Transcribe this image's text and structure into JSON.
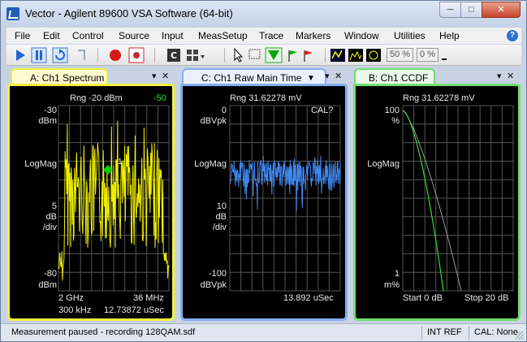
{
  "window": {
    "title": "Vector - Agilent 89600 VSA Software (64-bit)",
    "min_icon": "minimize-icon",
    "max_icon": "maximize-icon",
    "close_icon": "close-icon"
  },
  "menu": [
    "File",
    "Edit",
    "Control",
    "Source",
    "Input",
    "MeasSetup",
    "Trace",
    "Markers",
    "Window",
    "Utilities",
    "Help"
  ],
  "toolbar": {
    "zoom_a": "50 %",
    "zoom_b": "0 %"
  },
  "tabs": [
    {
      "label": "A: Ch1 Spectrum"
    },
    {
      "label": "C: Ch1 Raw Main Time"
    },
    {
      "label": "B: Ch1 CCDF"
    }
  ],
  "pane_a": {
    "range": "Rng -20 dBm",
    "marker_value": "-50",
    "top_val": "-30",
    "top_unit": "dBm",
    "format": "LogMag",
    "div_val": "5",
    "div_unit1": "dB",
    "div_unit2": "/div",
    "bottom_val": "-80",
    "bottom_unit": "dBm",
    "center": "2 GHz",
    "span": "36 MHz",
    "rbw": "300 kHz",
    "time": "12.73872 uSec",
    "marker_label": "1",
    "trace_color": "#f0f000",
    "marker_color": "#00d000"
  },
  "pane_c": {
    "range": "Rng 31.62278 mV",
    "cal": "CAL?",
    "top_val": "0",
    "top_unit": "dBVpk",
    "format": "LogMag",
    "div_val": "10",
    "div_unit1": "dB",
    "div_unit2": "/div",
    "bottom_val": "-100",
    "bottom_unit": "dBVpk",
    "time": "13.892 uSec",
    "trace_color": "#3f86f0"
  },
  "pane_b": {
    "range": "Rng 31.62278 mV",
    "top_val": "100",
    "top_unit": "%",
    "format": "LogMag",
    "bottom_val": "1",
    "bottom_unit": "m%",
    "start": "Start 0 dB",
    "stop": "Stop 20 dB",
    "trace_color": "#30e030"
  },
  "status": {
    "message": "Measurement paused - recording 128QAM.sdf",
    "ref": "INT REF",
    "cal": "CAL: None"
  }
}
